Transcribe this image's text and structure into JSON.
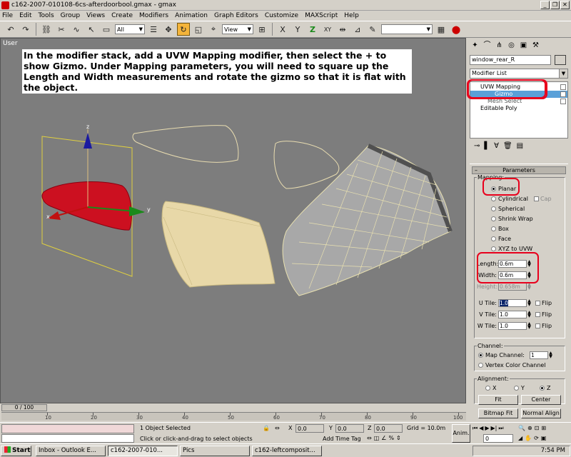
{
  "window": {
    "title": "c162-2007-010108-6cs-afterdoorbool.gmax - gmax",
    "controls": [
      "_",
      "❐",
      "✕"
    ]
  },
  "menu": [
    "File",
    "Edit",
    "Tools",
    "Group",
    "Views",
    "Create",
    "Modifiers",
    "Animation",
    "Graph Editors",
    "Customize",
    "MAXScript",
    "Help"
  ],
  "toolbar": {
    "filter_value": "All",
    "refcoord_value": "View"
  },
  "viewport": {
    "label": "User",
    "instruction": "In the modifier stack, add a UVW Mapping modifier, then select the + to show Gizmo.  Under Mapping parameters, you will need to square up the Length and Width measurements  and rotate the gizmo so that it is flat with the object.",
    "axis_x": "x",
    "axis_y": "y",
    "axis_z": "z"
  },
  "command_panel": {
    "object_name": "window_rear_R",
    "modifier_list_label": "Modifier List",
    "stack": [
      {
        "label": "UVW Mapping",
        "selected": false
      },
      {
        "label": "Gizmo",
        "selected": true
      },
      {
        "label": "Mesh Select",
        "selected": false
      },
      {
        "label": "Editable Poly",
        "selected": false
      }
    ],
    "rollout_title": "Parameters",
    "mapping_group": "Mapping:",
    "mapping_options": [
      "Planar",
      "Cylindrical",
      "Spherical",
      "Shrink Wrap",
      "Box",
      "Face",
      "XYZ to UVW"
    ],
    "mapping_selected": "Planar",
    "cap_label": "Cap",
    "length_label": "Length:",
    "length_value": "0.6m",
    "width_label": "Width:",
    "width_value": "0.6m",
    "height_label": "Height:",
    "height_value": "0.658m",
    "u_tile_label": "U Tile:",
    "u_tile_value": "1.0",
    "v_tile_label": "V Tile:",
    "v_tile_value": "1.0",
    "w_tile_label": "W Tile:",
    "w_tile_value": "1.0",
    "flip_label": "Flip",
    "channel_group": "Channel:",
    "map_channel_label": "Map Channel:",
    "map_channel_value": "1",
    "vertex_color_label": "Vertex Color Channel",
    "alignment_group": "Alignment:",
    "align_x": "X",
    "align_y": "Y",
    "align_z": "Z",
    "align_selected": "Z",
    "fit_label": "Fit",
    "center_label": "Center",
    "bitmap_fit_label": "Bitmap Fit",
    "normal_align_label": "Normal Align"
  },
  "timeline": {
    "slider_label": "0 / 100",
    "ticks": [
      "10",
      "20",
      "30",
      "40",
      "50",
      "60",
      "70",
      "80",
      "90",
      "100"
    ]
  },
  "status": {
    "selection": "1 Object Selected",
    "prompt": "Click or click-and-drag to select objects",
    "x_label": "X",
    "x_value": "0.0",
    "y_label": "Y",
    "y_value": "0.0",
    "z_label": "Z",
    "z_value": "0.0",
    "grid": "Grid = 10.0m",
    "add_time_tag": "Add Time Tag",
    "anim_label": "Anim.",
    "frame_value": "0"
  },
  "taskbar": {
    "start_label": "Start",
    "tasks": [
      {
        "label": "Inbox - Outlook E...",
        "active": false
      },
      {
        "label": "c162-2007-010...",
        "active": true
      },
      {
        "label": "Pics",
        "active": false
      },
      {
        "label": "c162-leftcomposit...",
        "active": false
      }
    ],
    "clock": "7:54 PM"
  },
  "colors": {
    "viewport_bg": "#7d7d7d",
    "highlight_red": "#e8001c",
    "selected_object": "#cc1020",
    "gizmo_yellow": "#e0d040",
    "panel_bg": "#d4d0c8"
  }
}
